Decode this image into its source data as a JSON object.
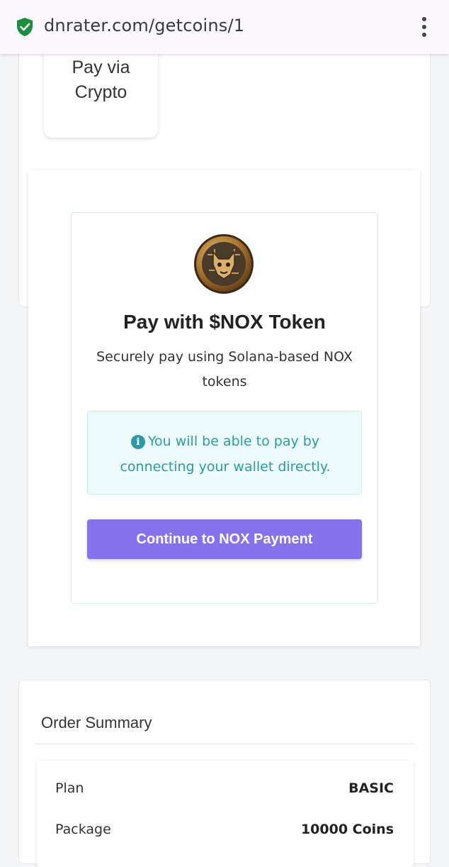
{
  "browser": {
    "url": "dnrater.com/getcoins/1",
    "secure_icon": "shield-check-icon",
    "menu_icon": "more-vert-icon"
  },
  "payment_method": {
    "label_line1": "Pay via",
    "label_line2": "Crypto"
  },
  "crypto_panel": {
    "token_logo_icon": "nox-token-coin-icon",
    "title": "Pay with $NOX Token",
    "subtitle": "Securely pay using Solana-based NOX tokens",
    "info_icon": "info-circle-icon",
    "info_text": "You will be able to pay by connecting your wallet directly.",
    "continue_label": "Continue to NOX Payment"
  },
  "order_summary": {
    "title": "Order Summary",
    "rows": [
      {
        "label": "Plan",
        "value": "BASIC"
      },
      {
        "label": "Package",
        "value": "10000 Coins"
      }
    ]
  },
  "colors": {
    "accent": "#8672ec",
    "info_text": "#2a9aa6",
    "info_bg": "#edfbfc",
    "secure": "#1e8e3e"
  }
}
